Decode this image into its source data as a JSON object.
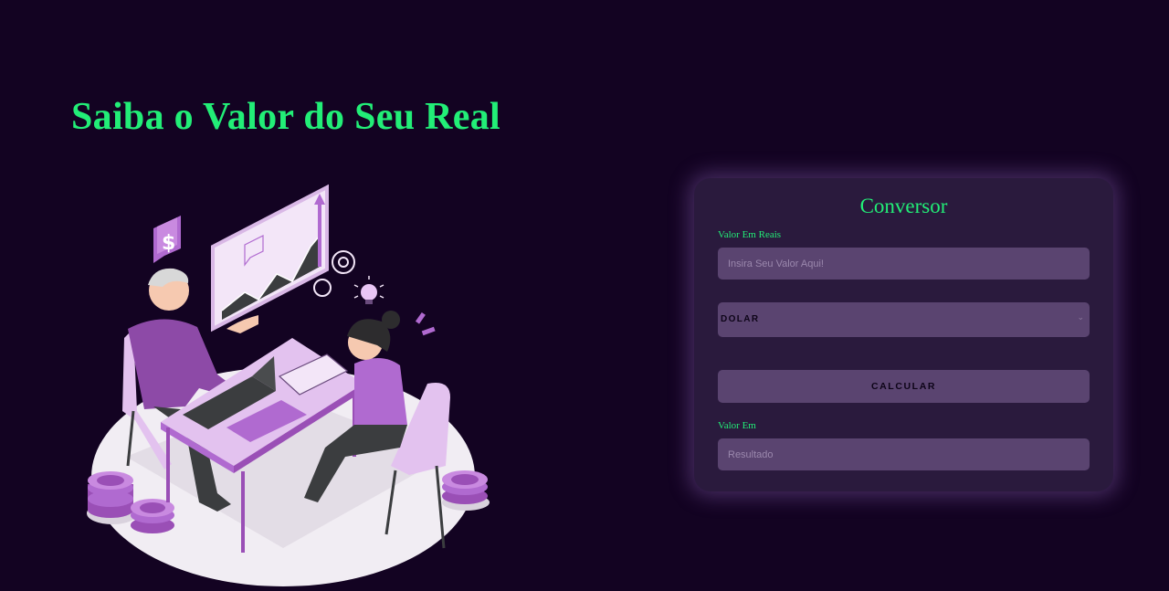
{
  "hero": {
    "title": "Saiba o Valor do Seu Real"
  },
  "converter": {
    "title": "Conversor",
    "amount_label": "Valor Em Reais",
    "amount_placeholder": "Insira Seu Valor Aqui!",
    "currency_selected": "DOLAR",
    "calculate_label": "CALCULAR",
    "result_label": "Valor Em",
    "result_placeholder": "Resultado"
  },
  "colors": {
    "accent": "#22ee77",
    "background": "#130322",
    "card": "#2a1a3d",
    "field": "#5a4470",
    "illustration_primary": "#b06ad0"
  },
  "icons": {
    "currency": "dollar-sign-icon",
    "select": "chevron-down-icon"
  }
}
